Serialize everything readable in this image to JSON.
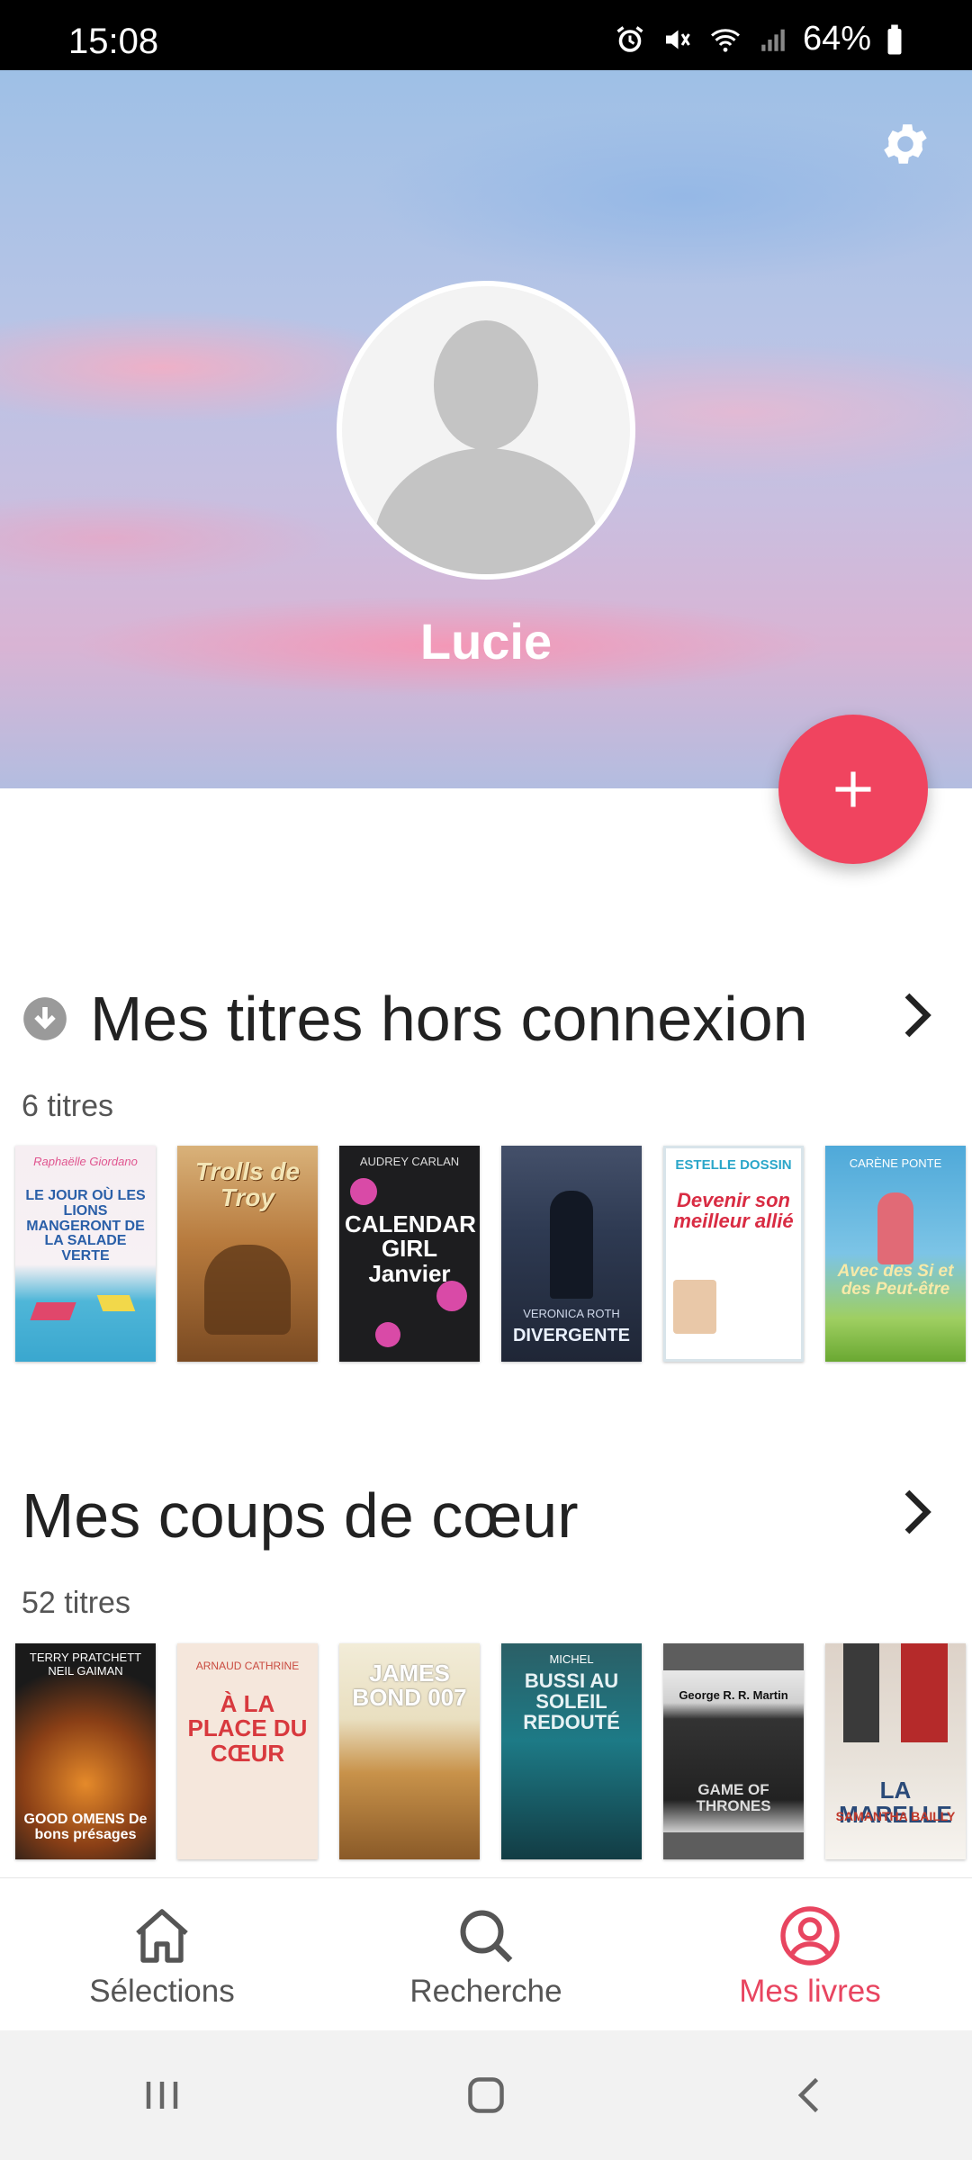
{
  "status_bar": {
    "time": "15:08",
    "battery": "64%",
    "icons": [
      "alarm-icon",
      "mute-icon",
      "wifi-icon",
      "signal-icon",
      "battery-icon"
    ]
  },
  "profile": {
    "name": "Lucie",
    "settings_icon": "gear-icon",
    "add_icon": "plus-icon"
  },
  "sections": [
    {
      "title": "Mes titres hors connexion",
      "count": "6 titres",
      "icon": "download-icon",
      "books": [
        {
          "title": "LE JOUR OÙ LES LIONS MANGERONT DE LA SALADE VERTE",
          "author": "Raphaëlle Giordano"
        },
        {
          "title": "Trolls de Troy",
          "author": ""
        },
        {
          "title": "CALENDAR GIRL Janvier",
          "author": "AUDREY CARLAN"
        },
        {
          "title": "DIVERGENTE",
          "author": "VERONICA ROTH"
        },
        {
          "title": "Devenir son meilleur allié",
          "author": "ESTELLE DOSSIN"
        },
        {
          "title": "Avec des Si et des Peut-être",
          "author": "CARÈNE PONTE"
        }
      ]
    },
    {
      "title": "Mes coups de cœur",
      "count": "52 titres",
      "icon": "",
      "books": [
        {
          "title": "GOOD OMENS De bons présages",
          "author": "TERRY PRATCHETT NEIL GAIMAN"
        },
        {
          "title": "À LA PLACE DU CŒUR",
          "author": "ARNAUD CATHRINE"
        },
        {
          "title": "JAMES BOND 007",
          "author": ""
        },
        {
          "title": "BUSSI AU SOLEIL REDOUTÉ",
          "author": "MICHEL"
        },
        {
          "title": "GAME OF THRONES",
          "author": "George R. R. Martin"
        },
        {
          "title": "LA MARELLE",
          "author": "SAMANTHA BAILLY"
        }
      ]
    }
  ],
  "bottom_nav": [
    {
      "label": "Sélections",
      "icon": "home-icon",
      "active": false
    },
    {
      "label": "Recherche",
      "icon": "search-icon",
      "active": false
    },
    {
      "label": "Mes livres",
      "icon": "account-icon",
      "active": true
    }
  ],
  "colors": {
    "accent": "#f0445f",
    "active_tab": "#e84560"
  }
}
